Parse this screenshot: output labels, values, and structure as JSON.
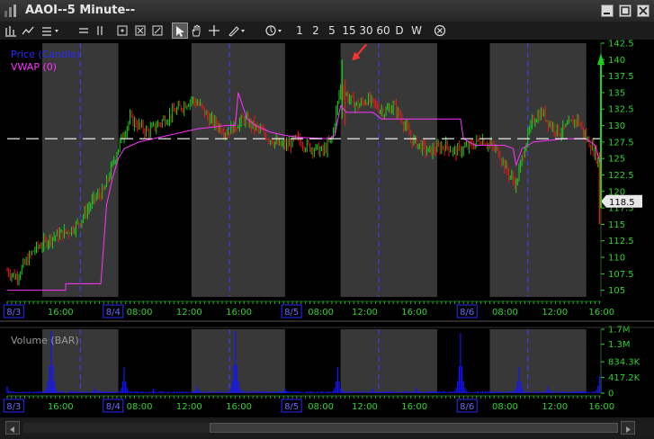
{
  "window": {
    "title": "AAOI--5 Minute--"
  },
  "toolbar": {
    "number_buttons": [
      "1",
      "2",
      "5",
      "15",
      "30",
      "60",
      "D",
      "W"
    ]
  },
  "colors": {
    "price_up": "#19d219",
    "price_down": "#e61919",
    "vwap": "#ff33ff",
    "volume": "#1414ff",
    "axis_text": "#2fd22f",
    "session_shade": "#383838",
    "day_divider": "#4040ff",
    "ref_line": "#ffffff",
    "arrow_annotation": "#ff3333"
  },
  "chart_data": {
    "type": "candlestick",
    "price_panel": {
      "legend": [
        "Price (Candle)",
        "VWAP (0)"
      ],
      "y_ticks": [
        "142.5",
        "140",
        "137.5",
        "135",
        "132.5",
        "130",
        "127.5",
        "125",
        "122.5",
        "120",
        "117.5",
        "115",
        "112.5",
        "110",
        "107.5",
        "105"
      ],
      "ylim": [
        104,
        142.5
      ],
      "last_price": "118.5",
      "reference_line": 128,
      "close_path": [
        [
          0,
          108
        ],
        [
          3,
          107
        ],
        [
          6,
          109
        ],
        [
          9,
          111
        ],
        [
          12,
          112
        ],
        [
          15,
          113
        ],
        [
          18,
          113.5
        ],
        [
          21,
          114
        ],
        [
          24,
          115
        ],
        [
          27,
          117
        ],
        [
          30,
          119
        ],
        [
          33,
          120
        ],
        [
          36,
          124
        ],
        [
          39,
          128
        ],
        [
          42,
          131
        ],
        [
          45,
          130
        ],
        [
          48,
          129
        ],
        [
          51,
          130
        ],
        [
          54,
          131
        ],
        [
          57,
          132
        ],
        [
          60,
          133
        ],
        [
          63,
          134
        ],
        [
          66,
          133
        ],
        [
          69,
          131
        ],
        [
          72,
          130
        ],
        [
          75,
          129
        ],
        [
          78,
          130
        ],
        [
          81,
          131
        ],
        [
          84,
          130
        ],
        [
          87,
          129
        ],
        [
          90,
          128
        ],
        [
          93,
          127
        ],
        [
          96,
          127
        ],
        [
          99,
          128
        ],
        [
          102,
          127
        ],
        [
          105,
          126.5
        ],
        [
          108,
          126
        ],
        [
          111,
          128
        ],
        [
          114,
          136
        ],
        [
          117,
          134
        ],
        [
          120,
          133
        ],
        [
          123,
          134
        ],
        [
          126,
          133
        ],
        [
          129,
          132
        ],
        [
          132,
          133
        ],
        [
          135,
          131
        ],
        [
          138,
          128
        ],
        [
          141,
          127
        ],
        [
          144,
          126
        ],
        [
          147,
          126.5
        ],
        [
          150,
          127
        ],
        [
          153,
          126
        ],
        [
          156,
          126.5
        ],
        [
          159,
          127
        ],
        [
          162,
          128
        ],
        [
          165,
          127
        ],
        [
          168,
          126
        ],
        [
          171,
          123
        ],
        [
          174,
          121
        ],
        [
          177,
          127
        ],
        [
          180,
          131
        ],
        [
          183,
          132
        ],
        [
          186,
          130
        ],
        [
          189,
          129
        ],
        [
          192,
          130
        ],
        [
          195,
          131
        ],
        [
          198,
          128
        ],
        [
          201,
          126
        ],
        [
          203,
          123
        ]
      ],
      "vwap_path": [
        [
          0,
          105
        ],
        [
          20,
          105
        ],
        [
          20,
          106
        ],
        [
          32,
          106
        ],
        [
          34,
          118
        ],
        [
          36,
          122
        ],
        [
          38,
          125
        ],
        [
          40,
          126.5
        ],
        [
          45,
          127.5
        ],
        [
          55,
          128.5
        ],
        [
          65,
          129.5
        ],
        [
          75,
          130
        ],
        [
          78,
          130
        ],
        [
          79,
          135
        ],
        [
          82,
          131
        ],
        [
          85,
          130
        ],
        [
          90,
          129
        ],
        [
          95,
          128.5
        ],
        [
          100,
          128.2
        ],
        [
          110,
          128
        ],
        [
          112,
          128.5
        ],
        [
          114,
          133
        ],
        [
          116,
          132
        ],
        [
          120,
          132
        ],
        [
          125,
          132
        ],
        [
          128,
          131
        ],
        [
          135,
          131
        ],
        [
          140,
          131
        ],
        [
          150,
          131
        ],
        [
          155,
          131
        ],
        [
          156,
          128
        ],
        [
          160,
          127
        ],
        [
          165,
          127
        ],
        [
          170,
          127
        ],
        [
          173,
          126.5
        ],
        [
          174,
          124
        ],
        [
          176,
          126.5
        ],
        [
          180,
          127.5
        ],
        [
          190,
          128
        ],
        [
          198,
          128
        ],
        [
          201,
          127
        ],
        [
          203,
          124
        ]
      ],
      "arrow_annotation": "down-left arrow at session high near 140"
    },
    "volume_panel": {
      "legend": [
        "Volume (BAR)"
      ],
      "y_ticks": [
        "1.7M",
        "1.3M",
        "834.3K",
        "417.2K",
        "0"
      ],
      "ylim": [
        0,
        1700000
      ],
      "spikes": [
        [
          0,
          180000
        ],
        [
          15,
          1650000
        ],
        [
          30,
          150000
        ],
        [
          40,
          700000
        ],
        [
          50,
          120000
        ],
        [
          65,
          180000
        ],
        [
          78,
          1650000
        ],
        [
          95,
          130000
        ],
        [
          113,
          700000
        ],
        [
          125,
          120000
        ],
        [
          140,
          150000
        ],
        [
          155,
          1600000
        ],
        [
          175,
          700000
        ],
        [
          185,
          180000
        ],
        [
          203,
          1000000
        ]
      ]
    },
    "x_axis": {
      "labels": [
        "8/3",
        "16:00",
        "8/4",
        "08:00",
        "12:00",
        "16:00",
        "8/5",
        "08:00",
        "12:00",
        "16:00",
        "8/6",
        "08:00",
        "12:00",
        "16:00"
      ],
      "date_labels": [
        "8/3",
        "8/4",
        "8/5",
        "8/6"
      ]
    }
  }
}
